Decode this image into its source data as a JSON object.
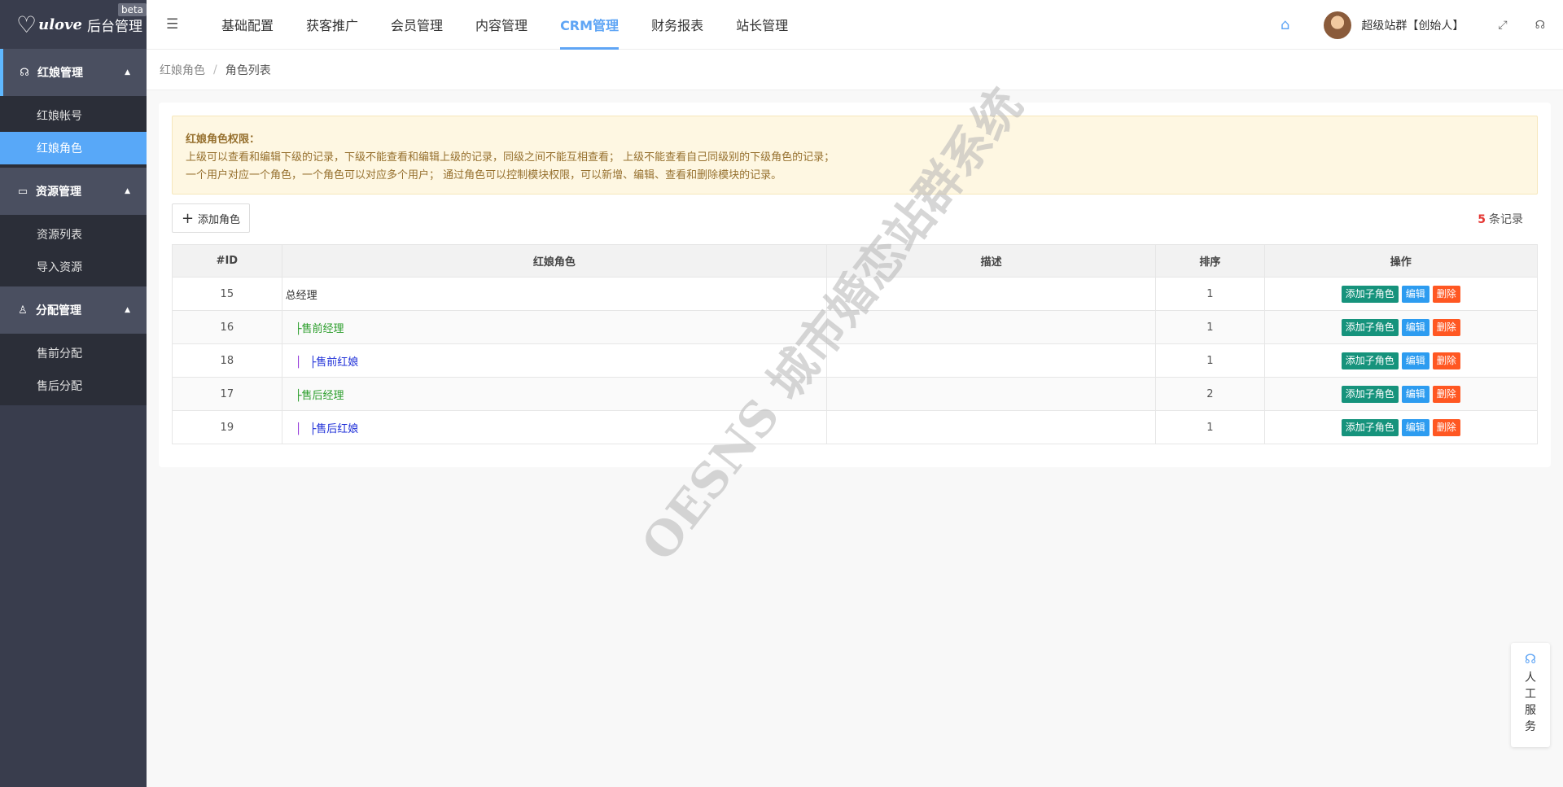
{
  "brand": {
    "script": "ulove",
    "title": "后台管理",
    "badge": "beta"
  },
  "sidebar": {
    "groups": [
      {
        "label": "红娘管理",
        "icon": "headset-icon",
        "items": [
          "红娘帐号",
          "红娘角色"
        ]
      },
      {
        "label": "资源管理",
        "icon": "folder-icon",
        "items": [
          "资源列表",
          "导入资源"
        ]
      },
      {
        "label": "分配管理",
        "icon": "user-icon",
        "items": [
          "售前分配",
          "售后分配"
        ]
      }
    ],
    "active_item": "红娘角色"
  },
  "topnav": {
    "items": [
      "基础配置",
      "获客推广",
      "会员管理",
      "内容管理",
      "CRM管理",
      "财务报表",
      "站长管理"
    ],
    "active": "CRM管理"
  },
  "user": {
    "name": "超级站群【创始人】"
  },
  "breadcrumb": {
    "parent": "红娘角色",
    "separator": "/",
    "current": "角色列表"
  },
  "notice": {
    "title": "红娘角色权限：",
    "line1": "上级可以查看和编辑下级的记录，下级不能查看和编辑上级的记录，同级之间不能互相查看； 上级不能查看自己同级别的下级角色的记录；",
    "line2": "一个用户对应一个角色，一个角色可以对应多个用户； 通过角色可以控制模块权限，可以新增、编辑、查看和删除模块的记录。"
  },
  "toolbar": {
    "add_label": "添加角色",
    "record_count": "5",
    "record_suffix": "条记录"
  },
  "table": {
    "headers": [
      "#ID",
      "红娘角色",
      "描述",
      "排序",
      "操作"
    ],
    "rows": [
      {
        "id": "15",
        "prefix": "",
        "name": "总经理",
        "level": 0,
        "desc": "",
        "sort": "1"
      },
      {
        "id": "16",
        "prefix": "├",
        "name": "售前经理",
        "level": 1,
        "desc": "",
        "sort": "1"
      },
      {
        "id": "18",
        "prefix": "├",
        "name": "售前红娘",
        "level": 2,
        "desc": "",
        "sort": "1"
      },
      {
        "id": "17",
        "prefix": "├",
        "name": "售后经理",
        "level": 1,
        "desc": "",
        "sort": "2"
      },
      {
        "id": "19",
        "prefix": "├",
        "name": "售后红娘",
        "level": 2,
        "desc": "",
        "sort": "1"
      }
    ],
    "actions": {
      "add_child": "添加子角色",
      "edit": "编辑",
      "delete": "删除"
    }
  },
  "watermark": "OESNS 城市婚恋站群系统",
  "service": {
    "label": "人工服务"
  },
  "colors": {
    "accent": "#5fa5f5",
    "sidebar": "#393d4d",
    "add_child": "#16937c",
    "edit": "#2d9cf0",
    "delete": "#ff5722"
  }
}
